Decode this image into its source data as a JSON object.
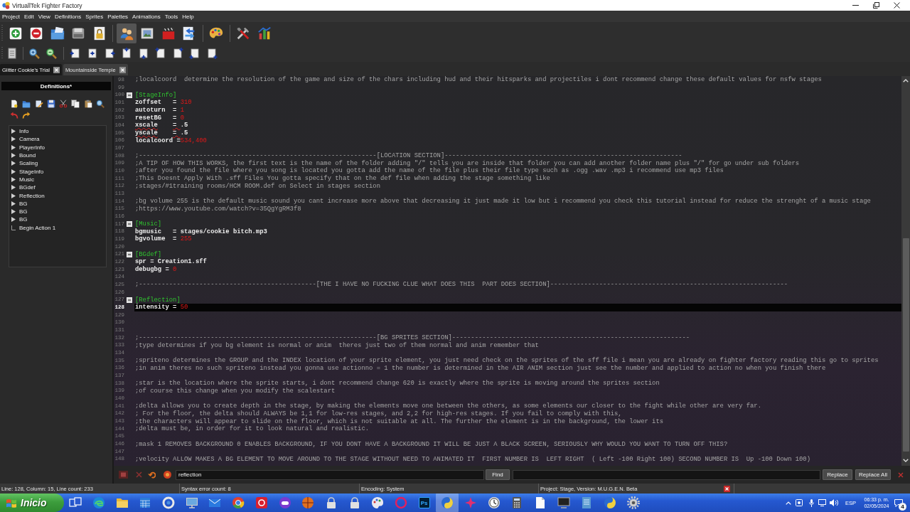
{
  "window": {
    "title": "VirtuallTek Fighter Factory"
  },
  "menu": [
    "Project",
    "Edit",
    "View",
    "Definitions",
    "Sprites",
    "Palettes",
    "Animations",
    "Tools",
    "Help"
  ],
  "toolbar": [
    {
      "selected": false
    },
    {
      "selected": false
    },
    {
      "selected": false
    },
    {
      "selected": false
    },
    {
      "selected": false
    },
    {
      "selected": true
    },
    {
      "selected": false
    },
    {
      "selected": false
    },
    {
      "selected": false
    },
    {
      "selected": false
    },
    {
      "selected": false
    },
    {
      "selected": false
    }
  ],
  "tabs": [
    {
      "label": "Glitter Cookie's Trial",
      "selected": true
    },
    {
      "label": "Mountainside Temple",
      "selected": false
    }
  ],
  "definitions": {
    "title": "Definitions*",
    "tree": [
      {
        "label": "Info",
        "kind": "node"
      },
      {
        "label": "Camera",
        "kind": "node"
      },
      {
        "label": "PlayerInfo",
        "kind": "node"
      },
      {
        "label": "Bound",
        "kind": "node"
      },
      {
        "label": "Scaling",
        "kind": "node"
      },
      {
        "label": "StageInfo",
        "kind": "node"
      },
      {
        "label": "Music",
        "kind": "node"
      },
      {
        "label": "BGdef",
        "kind": "node"
      },
      {
        "label": "Reflection",
        "kind": "node"
      },
      {
        "label": "BG",
        "kind": "node"
      },
      {
        "label": "BG",
        "kind": "node"
      },
      {
        "label": "BG",
        "kind": "node"
      },
      {
        "label": "Begin Action 1",
        "kind": "leaf"
      }
    ]
  },
  "editor": {
    "lines": [
      {
        "number": "98",
        "fold": false,
        "selected": false,
        "tokens": [
          {
            "kind": "comment",
            "text": ";localcoord  determine the resolution of the game and size of the chars including hud and their hitsparks and projectiles i dont recommend change these default values for nsfw stages"
          }
        ]
      },
      {
        "number": "99",
        "fold": false,
        "selected": false
      },
      {
        "number": "100",
        "fold": true,
        "selected": false,
        "tokens": [
          {
            "kind": "section",
            "text": "[StageInfo]"
          }
        ]
      },
      {
        "number": "101",
        "fold": false,
        "selected": false,
        "tokens": [
          {
            "kind": "key",
            "text": "zoffset   = "
          },
          {
            "kind": "value",
            "text": "310"
          }
        ]
      },
      {
        "number": "102",
        "fold": false,
        "selected": false,
        "tokens": [
          {
            "kind": "key",
            "text": "autoturn  = "
          },
          {
            "kind": "value",
            "text": "1"
          }
        ]
      },
      {
        "number": "103",
        "fold": false,
        "selected": false,
        "tokens": [
          {
            "kind": "key",
            "text": "resetBG   = "
          },
          {
            "kind": "value",
            "text": "0"
          }
        ]
      },
      {
        "number": "104",
        "fold": false,
        "selected": false,
        "tokens": [
          {
            "kind": "error",
            "text": "xscale"
          },
          {
            "kind": "error",
            "text": "    = "
          },
          {
            "kind": "key",
            "text": ".5"
          }
        ]
      },
      {
        "number": "105",
        "fold": false,
        "selected": false,
        "tokens": [
          {
            "kind": "error",
            "text": "yscale"
          },
          {
            "kind": "error",
            "text": "    = "
          },
          {
            "kind": "key",
            "text": ".5"
          }
        ]
      },
      {
        "number": "106",
        "fold": false,
        "selected": false,
        "tokens": [
          {
            "kind": "key",
            "text": "localcoord ="
          },
          {
            "kind": "value",
            "text": "534,400"
          }
        ]
      },
      {
        "number": "107",
        "fold": false,
        "selected": false
      },
      {
        "number": "108",
        "fold": false,
        "selected": false,
        "tokens": [
          {
            "kind": "comment",
            "text": ";---------------------------------------------------------------[LOCATION SECTION]---------------------------------------------------------------"
          }
        ]
      },
      {
        "number": "109",
        "fold": false,
        "selected": false,
        "tokens": [
          {
            "kind": "comment",
            "text": ";A TIP OF HOW THIS WORKS, the first text is the name of the folder adding \"/\" tells you are inside that folder you can add another folder name plus \"/\" for go under sub folders"
          }
        ]
      },
      {
        "number": "110",
        "fold": false,
        "selected": false,
        "tokens": [
          {
            "kind": "comment",
            "text": ";after you found the file where you song is located you gotta add the name of the file plus their file type such as .ogg .wav .mp3 i recommend use mp3 files"
          }
        ]
      },
      {
        "number": "111",
        "fold": false,
        "selected": false,
        "tokens": [
          {
            "kind": "comment",
            "text": ";This Doesnt Apply With .sff Files You gotta specify that on the def file when adding the stage something like"
          }
        ]
      },
      {
        "number": "112",
        "fold": false,
        "selected": false,
        "tokens": [
          {
            "kind": "comment",
            "text": ";stages/#1training rooms/HCM ROOM.def on Select in stages section"
          }
        ]
      },
      {
        "number": "113",
        "fold": false,
        "selected": false
      },
      {
        "number": "114",
        "fold": false,
        "selected": false,
        "tokens": [
          {
            "kind": "comment",
            "text": ";bg volume 255 is the default music sound you cant increase more above that decreasing it just made it low but i recommend you check this tutorial instead for reduce the strenght of a music stage"
          }
        ]
      },
      {
        "number": "115",
        "fold": false,
        "selected": false,
        "tokens": [
          {
            "kind": "comment",
            "text": ";https://www.youtube.com/watch?v=35QgYgRM3f8"
          }
        ]
      },
      {
        "number": "116",
        "fold": false,
        "selected": false
      },
      {
        "number": "117",
        "fold": true,
        "selected": false,
        "tokens": [
          {
            "kind": "section",
            "text": "[Music]"
          }
        ]
      },
      {
        "number": "118",
        "fold": false,
        "selected": false,
        "tokens": [
          {
            "kind": "key",
            "text": "bgmusic   = stages/cookie bitch.mp3"
          }
        ]
      },
      {
        "number": "119",
        "fold": false,
        "selected": false,
        "tokens": [
          {
            "kind": "key",
            "text": "bgvolume  = "
          },
          {
            "kind": "value",
            "text": "255"
          }
        ]
      },
      {
        "number": "120",
        "fold": false,
        "selected": false
      },
      {
        "number": "121",
        "fold": true,
        "selected": false,
        "tokens": [
          {
            "kind": "section",
            "text": "[BGdef]"
          }
        ]
      },
      {
        "number": "122",
        "fold": false,
        "selected": false,
        "tokens": [
          {
            "kind": "key",
            "text": "spr = Creation1.sff"
          }
        ]
      },
      {
        "number": "123",
        "fold": false,
        "selected": false,
        "tokens": [
          {
            "kind": "key",
            "text": "debugbg = "
          },
          {
            "kind": "value",
            "text": "0"
          }
        ]
      },
      {
        "number": "124",
        "fold": false,
        "selected": false
      },
      {
        "number": "125",
        "fold": false,
        "selected": false,
        "tokens": [
          {
            "kind": "comment",
            "text": ";-----------------------------------------------[THE I HAVE NO FUCKING CLUE WHAT DOES THIS  PART DOES SECTION]---------------------------------------------------------------"
          }
        ]
      },
      {
        "number": "126",
        "fold": false,
        "selected": false
      },
      {
        "number": "127",
        "fold": true,
        "selected": false,
        "tokens": [
          {
            "kind": "section",
            "text": "[Reflection]"
          }
        ]
      },
      {
        "number": "128",
        "fold": false,
        "selected": true,
        "tokens": [
          {
            "kind": "key",
            "text": "intensity = "
          },
          {
            "kind": "value",
            "text": "50"
          }
        ]
      },
      {
        "number": "129",
        "fold": false,
        "selected": false
      },
      {
        "number": "130",
        "fold": false,
        "selected": false
      },
      {
        "number": "131",
        "fold": false,
        "selected": false
      },
      {
        "number": "132",
        "fold": false,
        "selected": false,
        "tokens": [
          {
            "kind": "comment",
            "text": ";---------------------------------------------------------------[BG SPRITES SECTION]---------------------------------------------------------------"
          }
        ]
      },
      {
        "number": "133",
        "fold": false,
        "selected": false,
        "tokens": [
          {
            "kind": "comment",
            "text": ";type determines if you bg element is normal or anim  theres just two of them normal and anim remember that"
          }
        ]
      },
      {
        "number": "134",
        "fold": false,
        "selected": false
      },
      {
        "number": "135",
        "fold": false,
        "selected": false,
        "tokens": [
          {
            "kind": "comment",
            "text": ";spriteno determines the GROUP and the INDEX location of your sprite element, you just need check on the sprites of the sff file i mean you are already on fighter factory reading this go to sprites"
          }
        ]
      },
      {
        "number": "136",
        "fold": false,
        "selected": false,
        "tokens": [
          {
            "kind": "comment",
            "text": ";in anim theres no such spriteno instead you gonna use actionno = 1 the number is determined in the AIR ANIM section just see the number and applied to action no when you finish there"
          }
        ]
      },
      {
        "number": "137",
        "fold": false,
        "selected": false
      },
      {
        "number": "138",
        "fold": false,
        "selected": false,
        "tokens": [
          {
            "kind": "comment",
            "text": ";star is the location where the sprite starts, i dont recommend change 620 is exactly where the sprite is moving around the sprites section"
          }
        ]
      },
      {
        "number": "139",
        "fold": false,
        "selected": false,
        "tokens": [
          {
            "kind": "comment",
            "text": ";of course this change when you modify the scalestart"
          }
        ]
      },
      {
        "number": "140",
        "fold": false,
        "selected": false
      },
      {
        "number": "141",
        "fold": false,
        "selected": false,
        "tokens": [
          {
            "kind": "comment",
            "text": ";delta allows you to create depth in the stage, by making the elements move one between the others, as some elements our closer to the fight while other are very far."
          }
        ]
      },
      {
        "number": "142",
        "fold": false,
        "selected": false,
        "tokens": [
          {
            "kind": "comment",
            "text": "; For the floor, the delta should ALWAYS be 1,1 for low-res stages, and 2,2 for high-res stages. If you fail to comply with this,"
          }
        ]
      },
      {
        "number": "143",
        "fold": false,
        "selected": false,
        "tokens": [
          {
            "kind": "comment",
            "text": ";the characters will appear to slide on the floor, which is not suitable at all. The further the element is in the background, the lower its"
          }
        ]
      },
      {
        "number": "144",
        "fold": false,
        "selected": false,
        "tokens": [
          {
            "kind": "comment",
            "text": ";delta must be, in order for it to look natural and realistic."
          }
        ]
      },
      {
        "number": "145",
        "fold": false,
        "selected": false
      },
      {
        "number": "146",
        "fold": false,
        "selected": false,
        "tokens": [
          {
            "kind": "comment",
            "text": ";mask 1 REMOVES BACKGROUND 0 ENABLES BACKGROUND, IF YOU DONT HAVE A BACKGROUND IT WILL BE JUST A BLACK SCREEN, SERIOUSLY WHY WOULD YOU WANT TO TURN OFF THIS?"
          }
        ]
      },
      {
        "number": "147",
        "fold": false,
        "selected": false
      },
      {
        "number": "148",
        "fold": false,
        "selected": false,
        "tokens": [
          {
            "kind": "comment",
            "text": ";velocity ALLOW MAKES A BG ELEMENT TO MOVE AROUND TO THE STAGE WITHOUT NEED TO ANIMATED IT  FIRST NUMBER IS  LEFT RIGHT  ( Left -100 Right 100) SECOND NUMBER IS  Up -100 Down 100)"
          }
        ]
      }
    ]
  },
  "find_bar": {
    "search": {
      "value": "reflection"
    },
    "find_button": "Find",
    "replace_button": "Replace",
    "replace_all_button": "Replace All"
  },
  "status_bar": {
    "position": "Line: 128, Column: 15, Line count: 233",
    "syntax_errors": "Syntax error count: 8",
    "encoding": "Encoding: System",
    "project": "Project: Stage, Version: M.U.G.E.N. Beta"
  },
  "taskbar": {
    "start_button": "Inicio",
    "apps": [
      {
        "selected": false
      },
      {
        "selected": false
      },
      {
        "selected": false
      },
      {
        "selected": false
      },
      {
        "selected": false
      },
      {
        "selected": false
      },
      {
        "selected": false
      },
      {
        "selected": false
      },
      {
        "selected": false
      },
      {
        "selected": false
      },
      {
        "selected": false
      },
      {
        "selected": false
      },
      {
        "selected": false
      },
      {
        "selected": false
      },
      {
        "selected": false
      },
      {
        "label": "Ps",
        "selected": false
      },
      {
        "selected": true
      },
      {
        "selected": false
      },
      {
        "selected": false
      },
      {
        "selected": false
      },
      {
        "selected": false
      },
      {
        "selected": false
      },
      {
        "selected": false
      },
      {
        "selected": false
      },
      {
        "selected": false
      }
    ],
    "language": "ESP",
    "time": "06:33 p. m.",
    "date": "02/05/2024",
    "notification_count": "4"
  }
}
